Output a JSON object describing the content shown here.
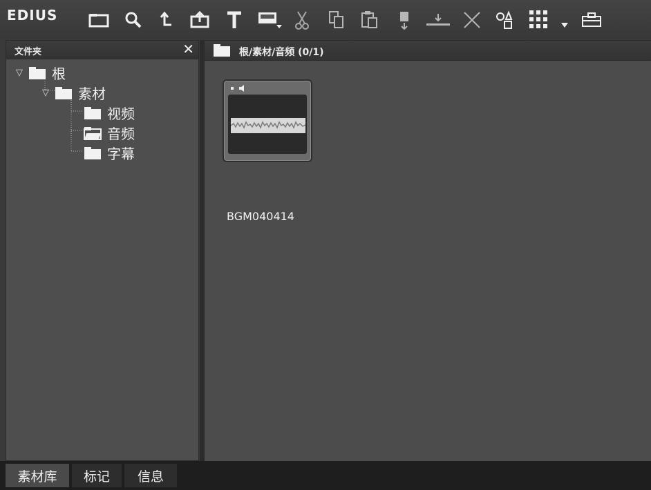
{
  "app": {
    "logo": "EDIUS"
  },
  "toolbar": {
    "buttons": [
      {
        "icon": "folder-icon"
      },
      {
        "icon": "search-icon"
      },
      {
        "icon": "up-arrow-icon"
      },
      {
        "icon": "export-icon"
      },
      {
        "icon": "title-text-icon"
      },
      {
        "icon": "color-bar-icon"
      },
      {
        "icon": "cut-icon"
      },
      {
        "icon": "copy-icon"
      },
      {
        "icon": "paste-icon"
      },
      {
        "icon": "add-to-player-icon"
      },
      {
        "icon": "add-to-timeline-icon"
      },
      {
        "icon": "delete-icon"
      },
      {
        "icon": "properties-icon"
      },
      {
        "icon": "view-mode-icon"
      },
      {
        "icon": "toolbox-icon"
      }
    ]
  },
  "folder_panel": {
    "title": "文件夹",
    "close_glyph": "✕",
    "tree": {
      "root": "根",
      "clips": "素材",
      "video": "视频",
      "audio": "音频",
      "titles": "字幕"
    }
  },
  "content": {
    "breadcrumb": "根/素材/音频 (0/1)",
    "clip": {
      "name": "BGM040414"
    }
  },
  "tabs": [
    "素材库",
    "标记",
    "信息"
  ]
}
